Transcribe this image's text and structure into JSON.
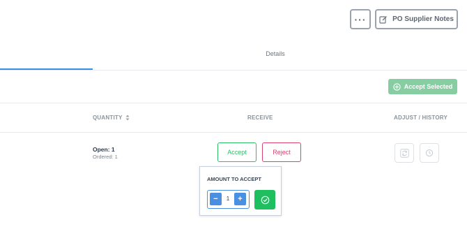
{
  "toolbar": {
    "more_label": "···",
    "notes_label": "PO Supplier Notes"
  },
  "tabs": {
    "details_label": "Details"
  },
  "actions": {
    "accept_selected_label": "Accept Selected"
  },
  "columns": {
    "quantity": "QUANTITY",
    "receive": "RECEIVE",
    "adjust_history": "ADJUST / HISTORY"
  },
  "row": {
    "open": "Open: 1",
    "ordered": "Ordered: 1",
    "accept_label": "Accept",
    "reject_label": "Reject"
  },
  "popup": {
    "title": "AMOUNT TO ACCEPT",
    "minus": "−",
    "plus": "+",
    "value": "1"
  },
  "colors": {
    "accent": "#4a90e2",
    "success": "#1fbf5f",
    "danger": "#d9426d"
  },
  "icons": [
    "more-icon",
    "edit-icon",
    "plus-circle-icon",
    "sort-icon",
    "refresh-icon",
    "history-icon",
    "check-circle-icon"
  ]
}
